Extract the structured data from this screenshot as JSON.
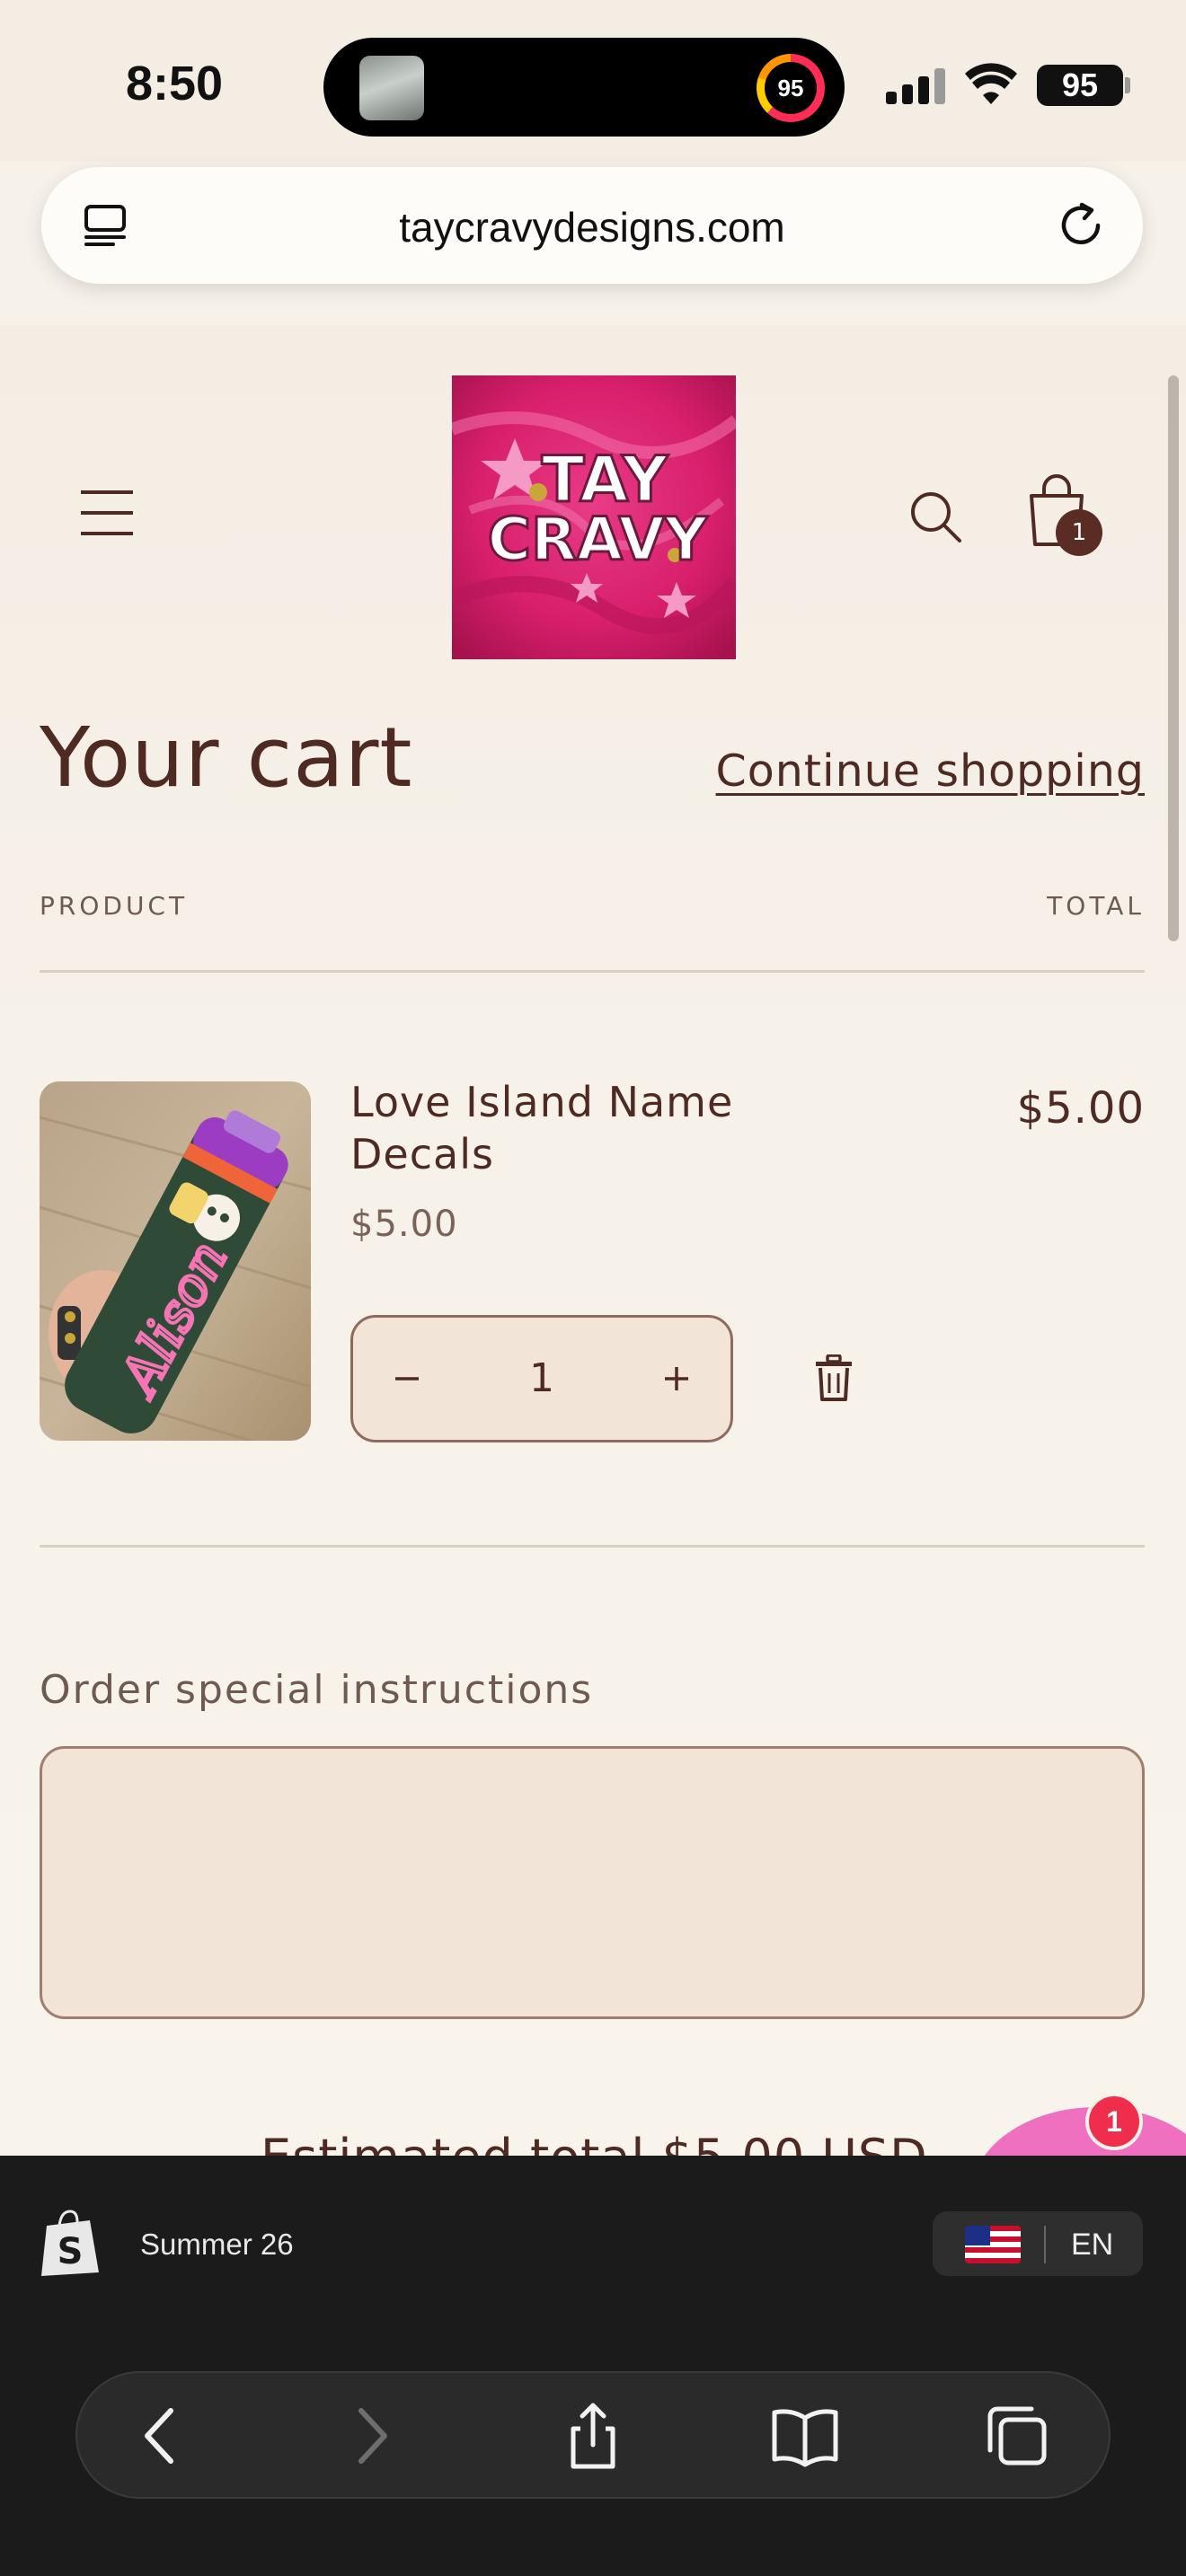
{
  "status_bar": {
    "time": "8:50",
    "activity_ring_value": "95",
    "battery_level": "95"
  },
  "browser": {
    "url": "taycravydesigns.com"
  },
  "header": {
    "logo_text_line1": "TAY",
    "logo_text_line2": "CRAVY",
    "cart_count": "1"
  },
  "cart": {
    "title": "Your cart",
    "continue_link": "Continue shopping",
    "column_product": "PRODUCT",
    "column_total": "TOTAL",
    "item": {
      "name": "Love Island Name Decals",
      "price": "$5.00",
      "line_total": "$5.00",
      "quantity": "1",
      "image_text": "Alison"
    },
    "qty_minus": "−",
    "qty_plus": "+",
    "instructions_label": "Order special instructions",
    "instructions_value": "",
    "estimated_total": "Estimated total   $5.00 USD"
  },
  "chat": {
    "badge": "1"
  },
  "shop_bar": {
    "store_name": "Summer 26",
    "language": "EN"
  },
  "colors": {
    "brand_dark": "#4f2a22",
    "page_bg": "#f6f1e9",
    "input_bg": "#f2e4d6",
    "logo_pink": "#d81f6c",
    "chat_pink": "#f070c0",
    "badge_red": "#ef2d4d"
  }
}
